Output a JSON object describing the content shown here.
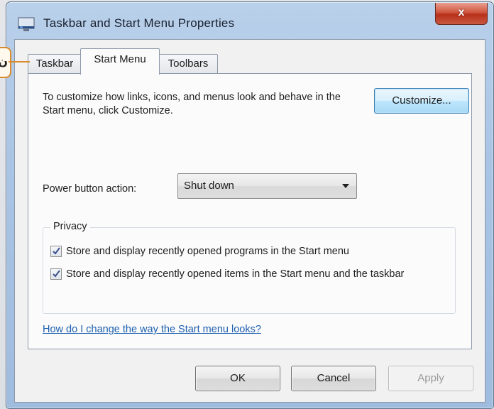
{
  "window": {
    "title": "Taskbar and Start Menu Properties",
    "close_glyph": "x"
  },
  "tabs": [
    {
      "label": "Taskbar",
      "active": false
    },
    {
      "label": "Start Menu",
      "active": true
    },
    {
      "label": "Toolbars",
      "active": false
    }
  ],
  "start_menu": {
    "description": "To customize how links, icons, and menus look and behave in the Start menu, click Customize.",
    "customize_label": "Customize...",
    "power_label": "Power button action:",
    "power_value": "Shut down",
    "privacy": {
      "title": "Privacy",
      "items": [
        {
          "label": "Store and display recently opened programs in the Start menu",
          "checked": true
        },
        {
          "label": "Store and display recently opened items in the Start menu and the taskbar",
          "checked": true
        }
      ]
    },
    "help_link": "How do I change the way the Start menu looks?"
  },
  "buttons": {
    "ok": "OK",
    "cancel": "Cancel",
    "apply": "Apply",
    "apply_enabled": false
  },
  "callout": {
    "text": "ن"
  },
  "colors": {
    "titlebar": "#a9c4e4",
    "close_button": "#c9452e",
    "link": "#1c5fae",
    "callout_border": "#d98a2a"
  }
}
